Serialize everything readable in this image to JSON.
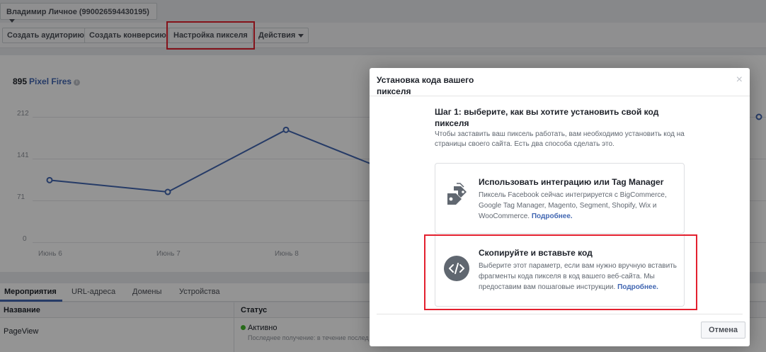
{
  "account": {
    "label": "Владимир Личное (990026594430195)"
  },
  "toolbar": {
    "create_audience": "Создать аудиторию",
    "create_conversion": "Создать конверсию",
    "pixel_setup": "Настройка пикселя",
    "actions": "Действия"
  },
  "summary": {
    "count": "895",
    "label": "Pixel Fires",
    "info_icon": "i"
  },
  "chart_data": {
    "type": "line",
    "categories": [
      "Июнь 6",
      "Июнь 7",
      "Июнь 8",
      "",
      "",
      "",
      ""
    ],
    "x_tick_labels": [
      "Июнь 6",
      "Июнь 7",
      "Июнь 8"
    ],
    "y_ticks": [
      "212",
      "141",
      "71",
      "0"
    ],
    "ylim": [
      0,
      212
    ],
    "series": [
      {
        "values": [
          105,
          85,
          190,
          110,
          null,
          null,
          212
        ]
      }
    ],
    "color": "#4267b2"
  },
  "tabs": [
    "Мероприятия",
    "URL-адреса",
    "Домены",
    "Устройства"
  ],
  "table": {
    "headers": [
      "Название",
      "Статус"
    ],
    "rows": [
      {
        "name": "PageView",
        "status": "Активно",
        "last": "Последнее получение: в течение послед"
      }
    ]
  },
  "dialog": {
    "title": "Установка кода вашего пикселя",
    "close": "×",
    "step_title": "Шаг 1: выберите, как вы хотите установить свой код пикселя",
    "step_desc": "Чтобы заставить ваш пиксель работать, вам необходимо установить код на страницы своего сайта. Есть два способа сделать это.",
    "option1": {
      "title": "Использовать интеграцию или Tag Manager",
      "desc": "Пиксель Facebook сейчас интегрируется с BigCommerce, Google Tag Manager, Magento, Segment, Shopify, Wix и WooCommerce.",
      "link": "Подробнее."
    },
    "option2": {
      "title": "Скопируйте и вставьте код",
      "desc": "Выберите этот параметр, если вам нужно вручную вставить фрагменты кода пикселя в код вашего веб-сайта. Мы предоставим вам пошаговые инструкции.",
      "link": "Подробнее.",
      "icon_glyph": "</>"
    },
    "cancel": "Отмена"
  }
}
